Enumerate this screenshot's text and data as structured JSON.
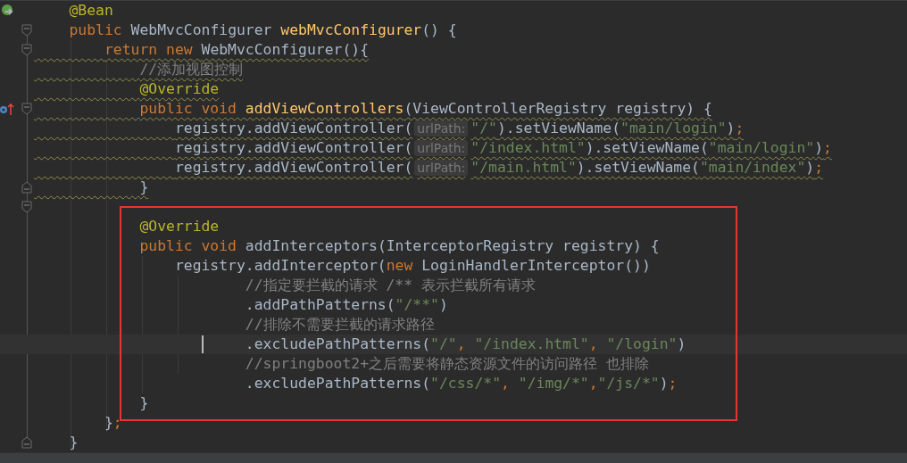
{
  "editor": {
    "lines": [
      {
        "gutter": [
          {
            "kind": "bean"
          }
        ],
        "warning": false,
        "current": false,
        "tokens": [
          {
            "text": "    @Bean",
            "kind": "annotation"
          }
        ]
      },
      {
        "gutter": [
          {
            "kind": "fold-start"
          }
        ],
        "warning": false,
        "current": false,
        "tokens": [
          {
            "text": "    public",
            "kind": "keyword"
          },
          {
            "text": " WebMvcConfigurer ",
            "kind": "plain"
          },
          {
            "text": "webMvcConfigurer",
            "kind": "method"
          },
          {
            "text": "() {",
            "kind": "plain"
          }
        ]
      },
      {
        "gutter": [
          {
            "kind": "fold-start"
          }
        ],
        "warning": true,
        "current": false,
        "tokens": [
          {
            "text": "        return new",
            "kind": "keyword"
          },
          {
            "text": " WebMvcConfigurer(){",
            "kind": "plain"
          }
        ]
      },
      {
        "warning": true,
        "current": false,
        "tokens": [
          {
            "text": "            //添加视图控制",
            "kind": "comment"
          }
        ]
      },
      {
        "warning": true,
        "current": false,
        "tokens": [
          {
            "text": "            @Override",
            "kind": "annotation"
          }
        ]
      },
      {
        "gutter": [
          {
            "kind": "override"
          },
          {
            "kind": "fold-start"
          }
        ],
        "warning": true,
        "current": false,
        "tokens": [
          {
            "text": "            public void ",
            "kind": "keyword"
          },
          {
            "text": "addViewControllers",
            "kind": "method"
          },
          {
            "text": "(ViewControllerRegistry registry) {",
            "kind": "plain"
          }
        ]
      },
      {
        "warning": true,
        "current": false,
        "tokens": [
          {
            "text": "                registry.addViewController(",
            "kind": "plain"
          },
          {
            "text": "urlPath:",
            "kind": "hint"
          },
          {
            "text": "\"/\"",
            "kind": "string"
          },
          {
            "text": ").setViewName(",
            "kind": "plain"
          },
          {
            "text": "\"main/login\"",
            "kind": "string"
          },
          {
            "text": ")",
            "kind": "plain"
          },
          {
            "text": ";",
            "kind": "keyword"
          }
        ]
      },
      {
        "warning": true,
        "current": false,
        "tokens": [
          {
            "text": "                registry.addViewController(",
            "kind": "plain"
          },
          {
            "text": "urlPath:",
            "kind": "hint"
          },
          {
            "text": "\"/index.html\"",
            "kind": "string"
          },
          {
            "text": ").setViewName(",
            "kind": "plain"
          },
          {
            "text": "\"main/login\"",
            "kind": "string"
          },
          {
            "text": ")",
            "kind": "plain"
          },
          {
            "text": ";",
            "kind": "keyword"
          }
        ]
      },
      {
        "warning": true,
        "current": false,
        "tokens": [
          {
            "text": "                registry.addViewController(",
            "kind": "plain"
          },
          {
            "text": "urlPath:",
            "kind": "hint"
          },
          {
            "text": "\"/main.html\"",
            "kind": "string"
          },
          {
            "text": ").setViewName(",
            "kind": "plain"
          },
          {
            "text": "\"main/index\"",
            "kind": "string"
          },
          {
            "text": ")",
            "kind": "plain"
          },
          {
            "text": ";",
            "kind": "keyword"
          }
        ]
      },
      {
        "gutter": [
          {
            "kind": "fold-end"
          }
        ],
        "warning": true,
        "current": false,
        "tokens": [
          {
            "text": "            }",
            "kind": "plain"
          }
        ]
      },
      {
        "gutter": [
          {
            "kind": "fold-start"
          }
        ],
        "warning": false,
        "current": false
      },
      {
        "warning": false,
        "current": false,
        "tokens": [
          {
            "text": "            @Override",
            "kind": "annotation"
          }
        ]
      },
      {
        "warning": false,
        "current": false,
        "tokens": [
          {
            "text": "            public void",
            "kind": "keyword"
          },
          {
            "text": " addInterceptors(InterceptorRegistry registry) {",
            "kind": "plain"
          }
        ]
      },
      {
        "warning": false,
        "current": false,
        "tokens": [
          {
            "text": "                registry.addInterceptor(",
            "kind": "plain"
          },
          {
            "text": "new",
            "kind": "keyword"
          },
          {
            "text": " LoginHandlerInterceptor())",
            "kind": "plain"
          }
        ]
      },
      {
        "warning": false,
        "current": false,
        "tokens": [
          {
            "text": "                        //指定要拦截的请求 /** 表示拦截所有请求",
            "kind": "comment"
          }
        ]
      },
      {
        "warning": false,
        "current": false,
        "tokens": [
          {
            "text": "                        .addPathPatterns(",
            "kind": "plain"
          },
          {
            "text": "\"/**\"",
            "kind": "string"
          },
          {
            "text": ")",
            "kind": "plain"
          }
        ]
      },
      {
        "warning": false,
        "current": false,
        "tokens": [
          {
            "text": "                        //排除不需要拦截的请求路径",
            "kind": "comment"
          }
        ]
      },
      {
        "warning": false,
        "current": true,
        "tokens": [
          {
            "text": "                        .excludePathPatterns(",
            "kind": "plain"
          },
          {
            "text": "\"/\"",
            "kind": "string"
          },
          {
            "text": ", ",
            "kind": "keyword"
          },
          {
            "text": "\"/index.html\"",
            "kind": "string"
          },
          {
            "text": ", ",
            "kind": "keyword"
          },
          {
            "text": "\"/login\"",
            "kind": "string"
          },
          {
            "text": ")",
            "kind": "plain"
          }
        ]
      },
      {
        "warning": false,
        "current": false,
        "tokens": [
          {
            "text": "                        //springboot2+之后需要将静态资源文件的访问路径 也排除",
            "kind": "comment"
          }
        ]
      },
      {
        "warning": false,
        "current": false,
        "tokens": [
          {
            "text": "                        .excludePathPatterns(",
            "kind": "plain"
          },
          {
            "text": "\"/css/*\"",
            "kind": "string"
          },
          {
            "text": ", ",
            "kind": "keyword"
          },
          {
            "text": "\"/img/*\"",
            "kind": "string"
          },
          {
            "text": ",",
            "kind": "keyword"
          },
          {
            "text": "\"/js/*\"",
            "kind": "string"
          },
          {
            "text": ")",
            "kind": "plain"
          },
          {
            "text": ";",
            "kind": "keyword"
          }
        ]
      },
      {
        "warning": false,
        "current": false,
        "tokens": [
          {
            "text": "            }",
            "kind": "plain"
          }
        ]
      },
      {
        "warning": false,
        "current": false,
        "tokens": [
          {
            "text": "        }",
            "kind": "plain"
          },
          {
            "text": ";",
            "kind": "keyword"
          }
        ]
      },
      {
        "gutter": [
          {
            "kind": "fold-end"
          }
        ],
        "warning": false,
        "current": false,
        "tokens": [
          {
            "text": "    }",
            "kind": "plain"
          }
        ]
      }
    ]
  }
}
